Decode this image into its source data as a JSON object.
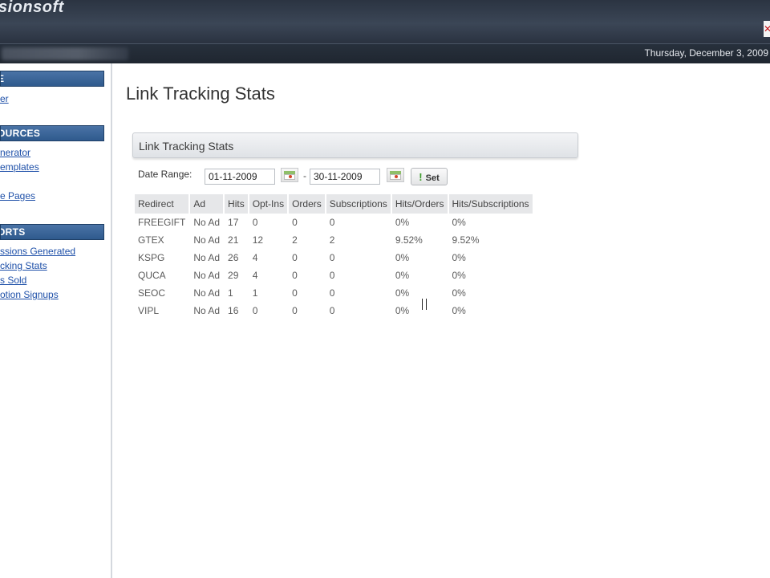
{
  "header": {
    "logo_text": "sionsoft",
    "date": "Thursday, December 3, 2009"
  },
  "sidebar": {
    "sections": [
      {
        "title": "E",
        "links": [
          "er"
        ]
      },
      {
        "title": "OURCES",
        "links": [
          "nerator",
          "emplates",
          "",
          "e Pages"
        ]
      },
      {
        "title": "ORTS",
        "links": [
          "ssions Generated",
          "cking Stats",
          "s Sold",
          "otion Signups"
        ]
      }
    ]
  },
  "main": {
    "title": "Link Tracking Stats",
    "panel_title": "Link Tracking Stats",
    "date_range_label": "Date Range:",
    "start_date": "01-11-2009",
    "end_date": "30-11-2009",
    "separator": "-",
    "set_label": "Set"
  },
  "table": {
    "headers": [
      "Redirect",
      "Ad",
      "Hits",
      "Opt-Ins",
      "Orders",
      "Subscriptions",
      "Hits/Orders",
      "Hits/Subscriptions"
    ],
    "rows": [
      [
        "FREEGIFT",
        "No Ad",
        "17",
        "0",
        "0",
        "0",
        "0%",
        "0%"
      ],
      [
        "GTEX",
        "No Ad",
        "21",
        "12",
        "2",
        "2",
        "9.52%",
        "9.52%"
      ],
      [
        "KSPG",
        "No Ad",
        "26",
        "4",
        "0",
        "0",
        "0%",
        "0%"
      ],
      [
        "QUCA",
        "No Ad",
        "29",
        "4",
        "0",
        "0",
        "0%",
        "0%"
      ],
      [
        "SEOC",
        "No Ad",
        "1",
        "1",
        "0",
        "0",
        "0%",
        "0%"
      ],
      [
        "VIPL",
        "No Ad",
        "16",
        "0",
        "0",
        "0",
        "0%",
        "0%"
      ]
    ]
  },
  "icons": {
    "calendar": "calendar-icon",
    "close": "close-icon",
    "set": "exclamation-icon"
  },
  "colors": {
    "sidebar_header": "#2f5a8d",
    "link": "#1d4fa8",
    "topbar": "#2b3442"
  }
}
